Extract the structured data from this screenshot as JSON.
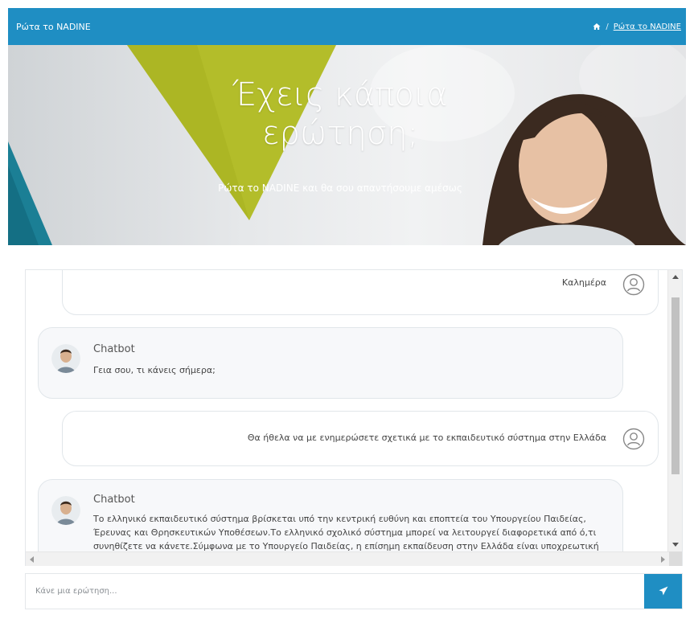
{
  "header": {
    "title": "Ρώτα το NADINE",
    "breadcrumb": {
      "separator": "/",
      "current": "Ρώτα το NADINE"
    }
  },
  "hero": {
    "title": "Έχεις κάποια ερώτηση;",
    "subtitle": "Ρώτα το NADINE και θα σου απαντήσουμε αμέσως"
  },
  "chat": {
    "messages": [
      {
        "sender": "user",
        "text": "Καλημέρα"
      },
      {
        "sender": "bot",
        "name": "Chatbot",
        "text": "Γεια σου, τι κάνεις σήμερα;"
      },
      {
        "sender": "user",
        "text": "Θα ήθελα να με ενημερώσετε σχετικά με το εκπαιδευτικό σύστημα στην Ελλάδα"
      },
      {
        "sender": "bot",
        "name": "Chatbot",
        "lines": [
          "Το ελληνικό εκπαιδευτικό σύστημα βρίσκεται υπό την κεντρική ευθύνη και εποπτεία του Υπουργείου Παιδείας,",
          "Έρευνας και Θρησκευτικών Υποθέσεων.Το ελληνικό σχολικό σύστημα μπορεί να λειτουργεί διαφορετικά από ό,τι",
          "συνηθίζετε να κάνετε.Σύμφωνα με το Υπουργείο Παιδείας, η επίσημη εκπαίδευση στην Ελλάδα είναι υποχρεωτική"
        ]
      }
    ]
  },
  "ask": {
    "placeholder": "Κάνε μια ερώτηση..."
  },
  "colors": {
    "accent": "#1f8ec3",
    "bubble_bot": "#f7f8fa",
    "border": "#e1e6ea"
  },
  "icons": {
    "home": "home-icon",
    "user": "user-circle-icon",
    "send": "paper-plane-icon"
  }
}
